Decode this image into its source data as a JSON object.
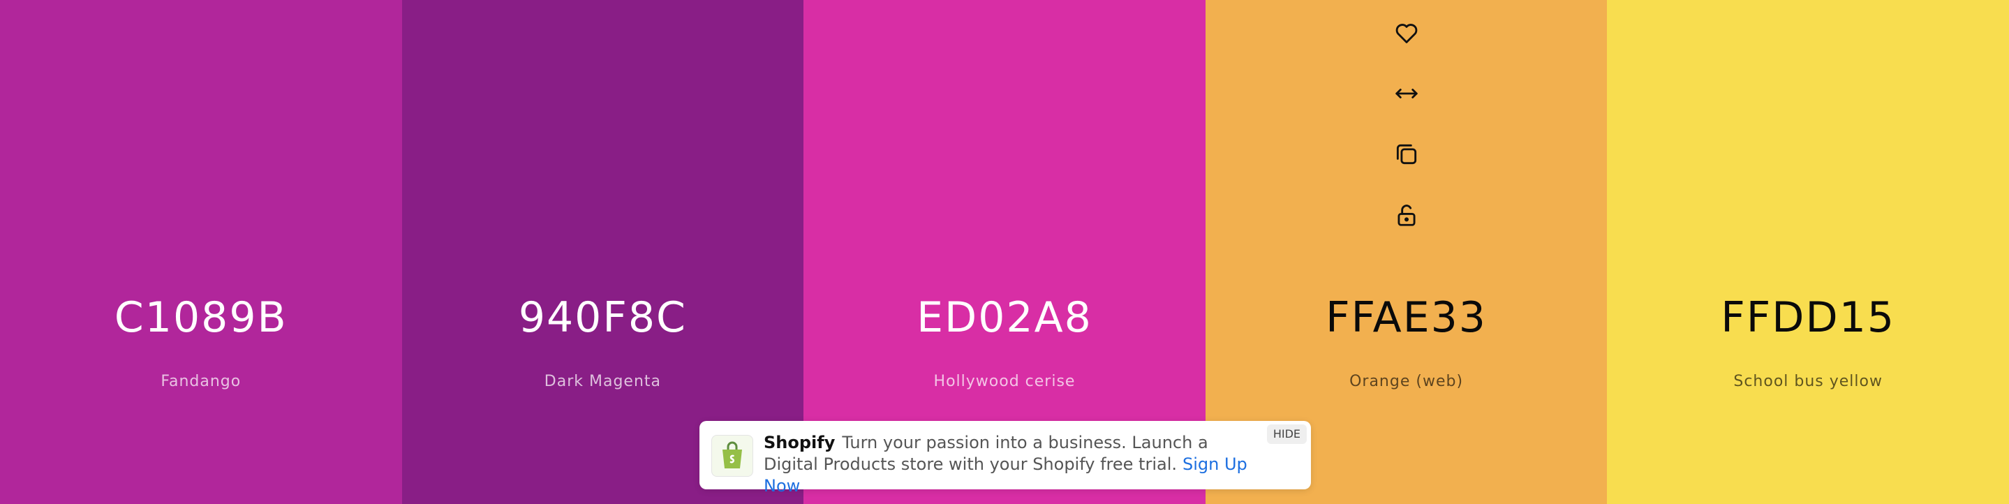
{
  "palette": {
    "colors": [
      {
        "hex": "C1089B",
        "name": "Fandango",
        "background": "#B1269B",
        "text_tone": "light"
      },
      {
        "hex": "940F8C",
        "name": "Dark Magenta",
        "background": "#891E86",
        "text_tone": "light"
      },
      {
        "hex": "ED02A8",
        "name": "Hollywood cerise",
        "background": "#D82EA5",
        "text_tone": "light"
      },
      {
        "hex": "FFAE33",
        "name": "Orange (web)",
        "background": "#F2B04F",
        "text_tone": "dark"
      },
      {
        "hex": "FFDD15",
        "name": "School bus yellow",
        "background": "#F8DD4F",
        "text_tone": "dark"
      }
    ],
    "hover_tools": {
      "column": 3,
      "icons": [
        "heart-icon",
        "drag-horizontal-icon",
        "copy-icon",
        "unlock-icon"
      ]
    }
  },
  "ad": {
    "brand": "Shopify",
    "message": "Turn your passion into a business. Launch a Digital Products store with your Shopify free trial.",
    "cta": "Sign Up Now",
    "hide_label": "HIDE",
    "logo_icon": "shopify-bag-icon",
    "logo_color": "#95BF47"
  }
}
